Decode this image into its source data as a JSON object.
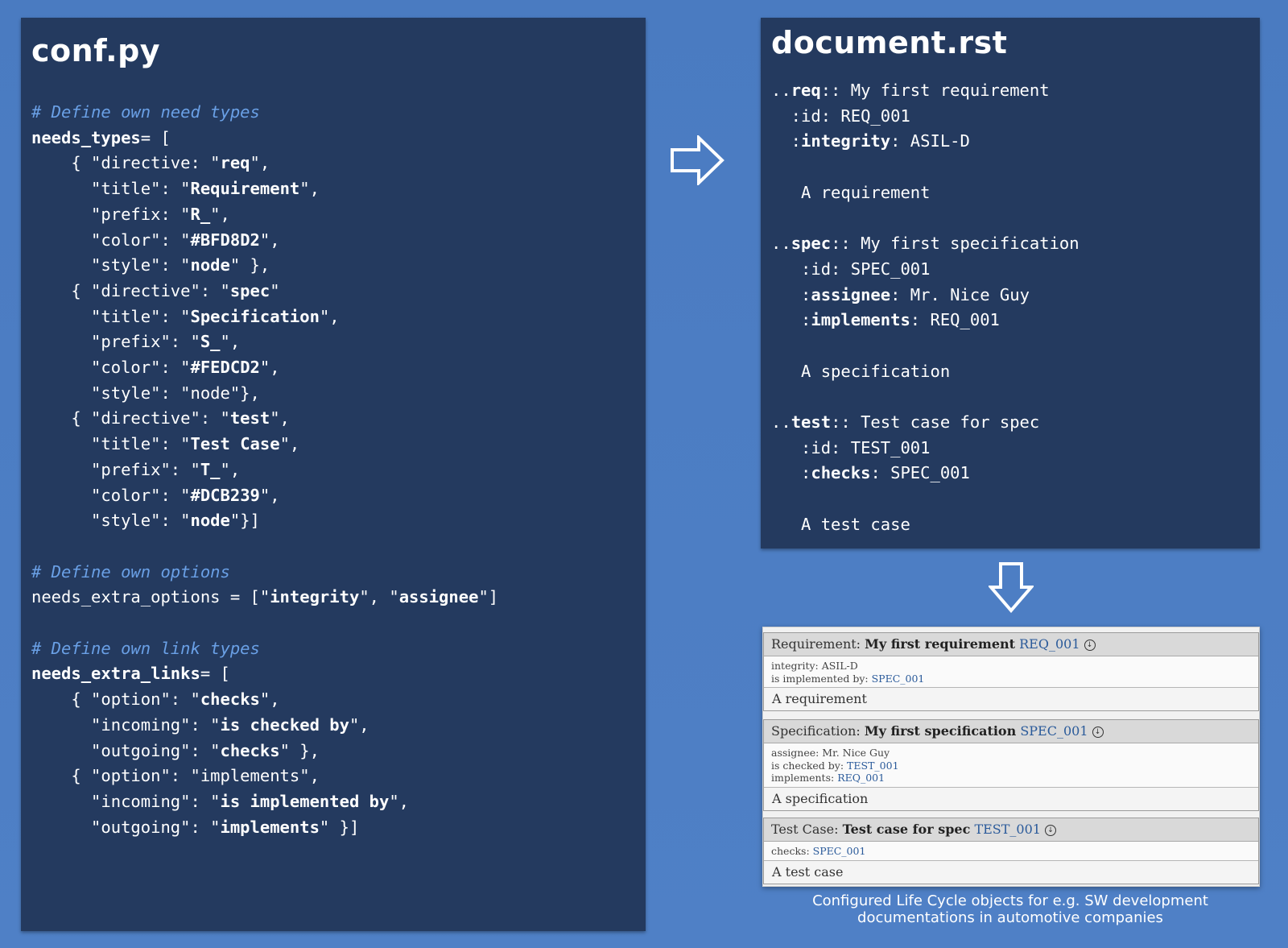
{
  "conf": {
    "title": "conf.py",
    "lines": [
      {
        "type": "comment",
        "text": "# Define own need types"
      },
      {
        "type": "code",
        "parts": [
          {
            "t": "needs_types",
            "k": 1
          },
          {
            "t": "= ["
          }
        ]
      },
      {
        "type": "code",
        "parts": [
          {
            "t": "    { \"directive: \""
          },
          {
            "t": "req",
            "k": 1
          },
          {
            "t": "\","
          }
        ]
      },
      {
        "type": "code",
        "parts": [
          {
            "t": "      \"title\": \""
          },
          {
            "t": "Requirement",
            "k": 1
          },
          {
            "t": "\","
          }
        ]
      },
      {
        "type": "code",
        "parts": [
          {
            "t": "      \"prefix: \""
          },
          {
            "t": "R_",
            "k": 1
          },
          {
            "t": "\","
          }
        ]
      },
      {
        "type": "code",
        "parts": [
          {
            "t": "      \"color\": \""
          },
          {
            "t": "#BFD8D2",
            "k": 1
          },
          {
            "t": "\","
          }
        ]
      },
      {
        "type": "code",
        "parts": [
          {
            "t": "      \"style\": \""
          },
          {
            "t": "node",
            "k": 1
          },
          {
            "t": "\" },"
          }
        ]
      },
      {
        "type": "code",
        "parts": [
          {
            "t": "    { \"directive\": \""
          },
          {
            "t": "spec",
            "k": 1
          },
          {
            "t": "\""
          }
        ]
      },
      {
        "type": "code",
        "parts": [
          {
            "t": "      \"title\": \""
          },
          {
            "t": "Specification",
            "k": 1
          },
          {
            "t": "\","
          }
        ]
      },
      {
        "type": "code",
        "parts": [
          {
            "t": "      \"prefix\": \""
          },
          {
            "t": "S_",
            "k": 1
          },
          {
            "t": "\","
          }
        ]
      },
      {
        "type": "code",
        "parts": [
          {
            "t": "      \"color\": \""
          },
          {
            "t": "#FEDCD2",
            "k": 1
          },
          {
            "t": "\","
          }
        ]
      },
      {
        "type": "code",
        "parts": [
          {
            "t": "      \"style\": \"node\"},"
          }
        ]
      },
      {
        "type": "code",
        "parts": [
          {
            "t": "    { \"directive\": \""
          },
          {
            "t": "test",
            "k": 1
          },
          {
            "t": "\","
          }
        ]
      },
      {
        "type": "code",
        "parts": [
          {
            "t": "      \"title\": \""
          },
          {
            "t": "Test Case",
            "k": 1
          },
          {
            "t": "\","
          }
        ]
      },
      {
        "type": "code",
        "parts": [
          {
            "t": "      \"prefix\": \""
          },
          {
            "t": "T_",
            "k": 1
          },
          {
            "t": "\","
          }
        ]
      },
      {
        "type": "code",
        "parts": [
          {
            "t": "      \"color\": \""
          },
          {
            "t": "#DCB239",
            "k": 1
          },
          {
            "t": "\","
          }
        ]
      },
      {
        "type": "code",
        "parts": [
          {
            "t": "      \"style\": \""
          },
          {
            "t": "node",
            "k": 1
          },
          {
            "t": "\"}]"
          }
        ]
      },
      {
        "type": "blank"
      },
      {
        "type": "comment",
        "text": "# Define own options"
      },
      {
        "type": "code",
        "parts": [
          {
            "t": "needs_extra_options = [\""
          },
          {
            "t": "integrity",
            "k": 1
          },
          {
            "t": "\", \""
          },
          {
            "t": "assignee",
            "k": 1
          },
          {
            "t": "\"]"
          }
        ]
      },
      {
        "type": "blank"
      },
      {
        "type": "comment",
        "text": "# Define own link types"
      },
      {
        "type": "code",
        "parts": [
          {
            "t": "needs_extra_links",
            "k": 1
          },
          {
            "t": "= ["
          }
        ]
      },
      {
        "type": "code",
        "parts": [
          {
            "t": "    { \"option\": \""
          },
          {
            "t": "checks",
            "k": 1
          },
          {
            "t": "\","
          }
        ]
      },
      {
        "type": "code",
        "parts": [
          {
            "t": "      \"incoming\": \""
          },
          {
            "t": "is checked by",
            "k": 1
          },
          {
            "t": "\","
          }
        ]
      },
      {
        "type": "code",
        "parts": [
          {
            "t": "      \"outgoing\": \""
          },
          {
            "t": "checks",
            "k": 1
          },
          {
            "t": "\" },"
          }
        ]
      },
      {
        "type": "code",
        "parts": [
          {
            "t": "    { \"option\": \"implements\","
          }
        ]
      },
      {
        "type": "code",
        "parts": [
          {
            "t": "      \"incoming\": \""
          },
          {
            "t": "is implemented by",
            "k": 1
          },
          {
            "t": "\","
          }
        ]
      },
      {
        "type": "code",
        "parts": [
          {
            "t": "      \"outgoing\": \""
          },
          {
            "t": "implements",
            "k": 1
          },
          {
            "t": "\" }]"
          }
        ]
      }
    ]
  },
  "doc": {
    "title": "document.rst",
    "lines": [
      {
        "type": "code",
        "parts": [
          {
            "t": ".."
          },
          {
            "t": "req",
            "k": 1
          },
          {
            "t": ":: My first requirement"
          }
        ]
      },
      {
        "type": "code",
        "parts": [
          {
            "t": "  :id: REQ_001"
          }
        ]
      },
      {
        "type": "code",
        "parts": [
          {
            "t": "  :"
          },
          {
            "t": "integrity",
            "k": 1
          },
          {
            "t": ": ASIL-D"
          }
        ]
      },
      {
        "type": "blank"
      },
      {
        "type": "code",
        "parts": [
          {
            "t": "   A requirement"
          }
        ]
      },
      {
        "type": "blank"
      },
      {
        "type": "code",
        "parts": [
          {
            "t": ".."
          },
          {
            "t": "spec",
            "k": 1
          },
          {
            "t": ":: My first specification"
          }
        ]
      },
      {
        "type": "code",
        "parts": [
          {
            "t": "   :id: SPEC_001"
          }
        ]
      },
      {
        "type": "code",
        "parts": [
          {
            "t": "   :"
          },
          {
            "t": "assignee",
            "k": 1
          },
          {
            "t": ": Mr. Nice Guy"
          }
        ]
      },
      {
        "type": "code",
        "parts": [
          {
            "t": "   :"
          },
          {
            "t": "implements",
            "k": 1
          },
          {
            "t": ": REQ_001"
          }
        ]
      },
      {
        "type": "blank"
      },
      {
        "type": "code",
        "parts": [
          {
            "t": "   A specification"
          }
        ]
      },
      {
        "type": "blank"
      },
      {
        "type": "code",
        "parts": [
          {
            "t": ".."
          },
          {
            "t": "test",
            "k": 1
          },
          {
            "t": ":: Test case for spec"
          }
        ]
      },
      {
        "type": "code",
        "parts": [
          {
            "t": "   :id: TEST_001"
          }
        ]
      },
      {
        "type": "code",
        "parts": [
          {
            "t": "   :"
          },
          {
            "t": "checks",
            "k": 1
          },
          {
            "t": ": SPEC_001"
          }
        ]
      },
      {
        "type": "blank"
      },
      {
        "type": "code",
        "parts": [
          {
            "t": "   A test case"
          }
        ]
      }
    ]
  },
  "rendered": {
    "req": {
      "type_label": "Requirement:",
      "title": "My first requirement",
      "id": "REQ_001",
      "meta1_label": "integrity: ASIL-D",
      "meta2_label": "is implemented by:",
      "meta2_link": "SPEC_001",
      "content": "A requirement"
    },
    "spec": {
      "type_label": "Specification:",
      "title": "My first specification",
      "id": "SPEC_001",
      "meta1_label": "assignee: Mr. Nice Guy",
      "meta2_label": "is checked by:",
      "meta2_link": "TEST_001",
      "meta3_label": "implements:",
      "meta3_link": "REQ_001",
      "content": "A specification"
    },
    "test": {
      "type_label": "Test Case:",
      "title": "Test case for spec",
      "id": "TEST_001",
      "meta1_label": "checks:",
      "meta1_link": "SPEC_001",
      "content": "A test case"
    }
  },
  "caption": {
    "line1": "Configured Life Cycle objects for e.g. SW development",
    "line2": "documentations in automotive companies"
  },
  "icons": {
    "arrow_right": "right-arrow-outline-icon",
    "arrow_down": "down-arrow-outline-icon",
    "download": "download-circle-icon"
  },
  "colors": {
    "panel": "#243a5f",
    "background": "#4a7bc1",
    "comment": "#6aa0e6",
    "link": "#2a5a9a"
  }
}
